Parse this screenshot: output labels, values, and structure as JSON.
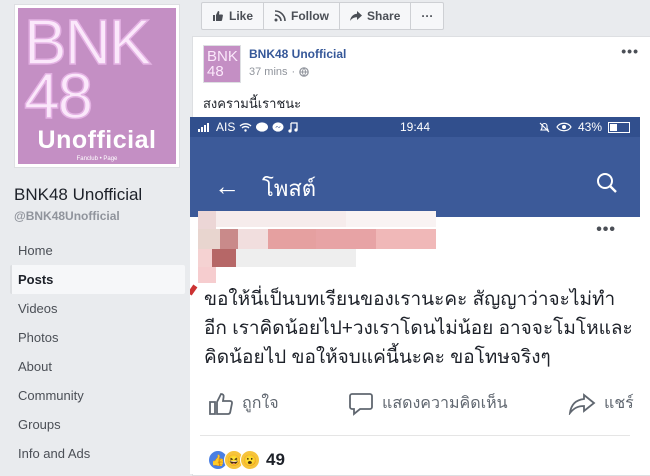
{
  "sidebar": {
    "cover": {
      "logo_top": "BNK",
      "logo_mid": "48",
      "logo_word": "Unofficial",
      "logo_sub": "Fanclub  •  Page"
    },
    "page_name": "BNK48 Unofficial",
    "handle": "@BNK48Unofficial",
    "nav": [
      {
        "label": "Home"
      },
      {
        "label": "Posts"
      },
      {
        "label": "Videos"
      },
      {
        "label": "Photos"
      },
      {
        "label": "About"
      },
      {
        "label": "Community"
      },
      {
        "label": "Groups"
      },
      {
        "label": "Info and Ads"
      }
    ]
  },
  "action_bar": {
    "like": "Like",
    "follow": "Follow",
    "share": "Share",
    "more": "···"
  },
  "post": {
    "author": "BNK48 Unofficial",
    "time": "37 mins",
    "time_sep": "·",
    "dots": "•••",
    "text": "สงครามนี้เราชนะ",
    "avatar_top": "BNK",
    "avatar_bottom": "48"
  },
  "screenshot": {
    "status_bar": {
      "carrier": "AIS",
      "time": "19:44",
      "battery": "43%"
    },
    "appbar": {
      "back": "←",
      "title": "โพสต์"
    },
    "dots": "•••",
    "body": "ขอให้นี่เป็นบทเรียนของเรานะคะ สัญญาว่าจะไม่ทำอีก เราคิดน้อยไป+วงเราโดนไม่น้อย อาจจะโมโหและคิดน้อยไป ขอให้จบแค่นี้นะคะ ขอโทษจริงๆ",
    "actions": {
      "like": "ถูกใจ",
      "comment": "แสดงความคิดเห็น",
      "share": "แชร์"
    },
    "reactions_count": "49"
  },
  "colors": {
    "fb_blue": "#3c5a99",
    "status_blue": "#314f8d",
    "link_blue": "#365899",
    "logo_pink": "#c48fc4"
  }
}
